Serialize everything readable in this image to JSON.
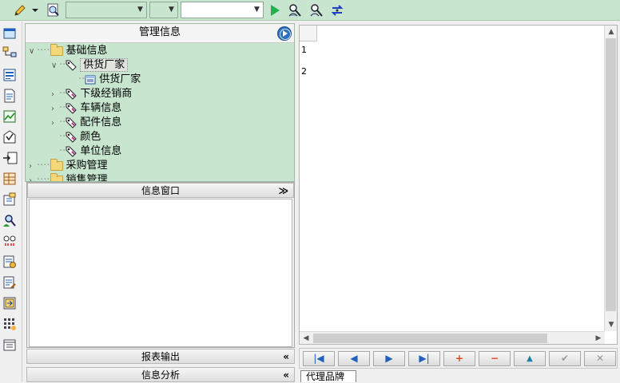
{
  "toolbar": {
    "combo1_value": "",
    "combo2_value": "",
    "combo3_value": ""
  },
  "tree_panel": {
    "title": "管理信息",
    "nodes": [
      {
        "label": "基础信息"
      },
      {
        "label": "供货厂家"
      },
      {
        "label": "供货厂家"
      },
      {
        "label": "下级经销商"
      },
      {
        "label": "车辆信息"
      },
      {
        "label": "配件信息"
      },
      {
        "label": "颜色"
      },
      {
        "label": "单位信息"
      },
      {
        "label": "采购管理"
      },
      {
        "label": "销售管理"
      }
    ]
  },
  "info_panel": {
    "title": "信息窗口",
    "report_title": "报表输出",
    "analysis_title": "信息分析"
  },
  "grid": {
    "row_numbers": [
      "1",
      "2"
    ]
  },
  "nav": {
    "first": "|◀",
    "prev": "◀",
    "next": "▶",
    "last": "▶|",
    "add": "+",
    "delete": "−",
    "up": "▲",
    "confirm": "✔",
    "cancel": "✕"
  },
  "bottom_tab": {
    "label": "代理品牌"
  },
  "colors": {
    "accent_green": "#c8e6cf",
    "play_green": "#22b14c",
    "add_red": "#e04a1a",
    "nav_blue": "#1f5fbf"
  }
}
